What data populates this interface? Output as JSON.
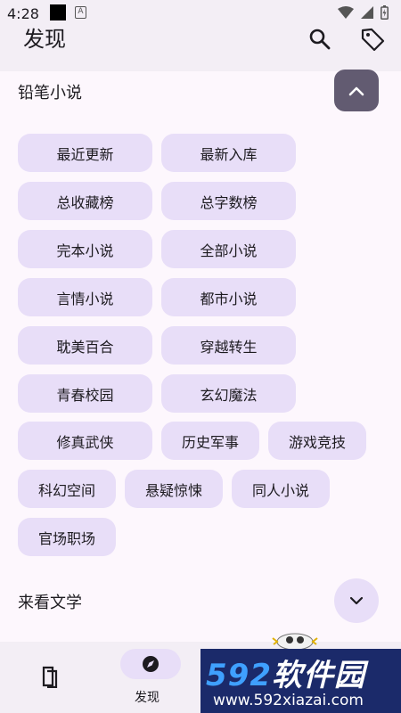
{
  "status_bar": {
    "time": "4:28"
  },
  "header": {
    "title": "发现"
  },
  "sections": [
    {
      "title": "铅笔小说",
      "expanded": true,
      "items": [
        "最近更新",
        "最新入库",
        "总收藏榜",
        "总字数榜",
        "完本小说",
        "全部小说",
        "言情小说",
        "都市小说",
        "耽美百合",
        "穿越转生",
        "青春校园",
        "玄幻魔法",
        "修真武侠",
        "历史军事",
        "游戏竞技",
        "科幻空间",
        "悬疑惊悚",
        "同人小说",
        "官场职场"
      ]
    },
    {
      "title": "来看文学",
      "expanded": false
    }
  ],
  "bottom_nav": {
    "items": [
      {
        "icon": "bookshelf-icon"
      },
      {
        "icon": "compass-icon",
        "label": "发现",
        "active": true
      }
    ]
  },
  "watermark": {
    "logo_num": "592",
    "logo_text": "软件园",
    "url": "www.592xiazai.com"
  },
  "colors": {
    "background": "#fdf7fd",
    "bar": "#f3eef5",
    "chip": "#e8def8",
    "toggle_active": "#625b71"
  }
}
